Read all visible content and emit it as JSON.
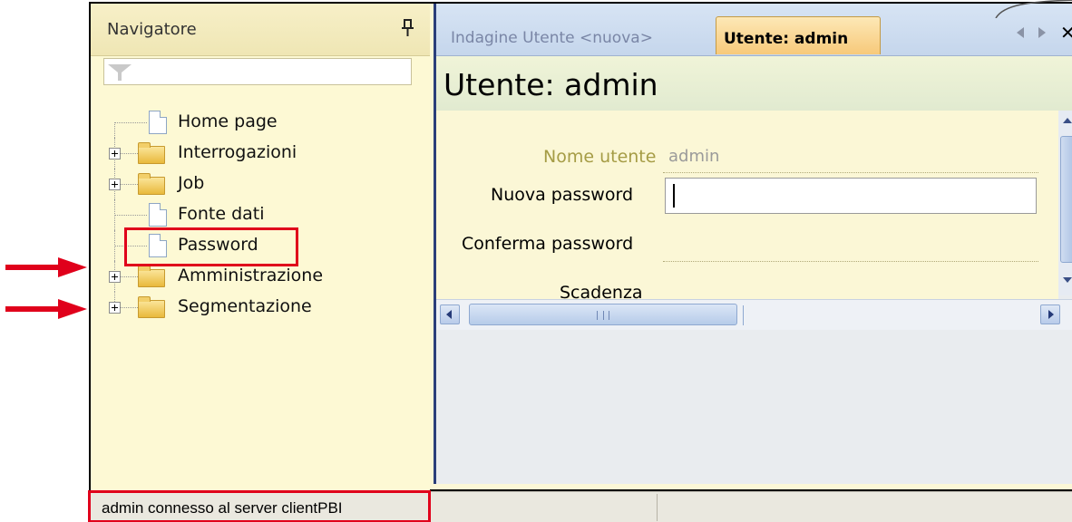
{
  "navigator": {
    "title": "Navigatore",
    "filter_placeholder": "",
    "tree": [
      {
        "label": "Home page",
        "type": "document"
      },
      {
        "label": "Interrogazioni",
        "type": "folder"
      },
      {
        "label": "Job",
        "type": "folder"
      },
      {
        "label": "Fonte dati",
        "type": "document"
      },
      {
        "label": "Password",
        "type": "document"
      },
      {
        "label": "Amministrazione",
        "type": "folder"
      },
      {
        "label": "Segmentazione",
        "type": "folder"
      }
    ]
  },
  "tabs": [
    {
      "label": "Indagine Utente  <nuova>",
      "active": false
    },
    {
      "label": "Utente: admin",
      "active": true
    }
  ],
  "document": {
    "title": "Utente: admin",
    "fields": {
      "username_label": "Nome utente",
      "username_value": "admin",
      "new_password_label": "Nuova password",
      "new_password_value": "",
      "confirm_password_label": "Conferma password",
      "expiry_label": "Scadenza"
    }
  },
  "statusbar": {
    "text": "admin connesso al server clientPBI"
  },
  "colors": {
    "highlight": "#e0001b",
    "active_tab": "#f7c97a",
    "navigator_bg": "#fdf9d4"
  }
}
